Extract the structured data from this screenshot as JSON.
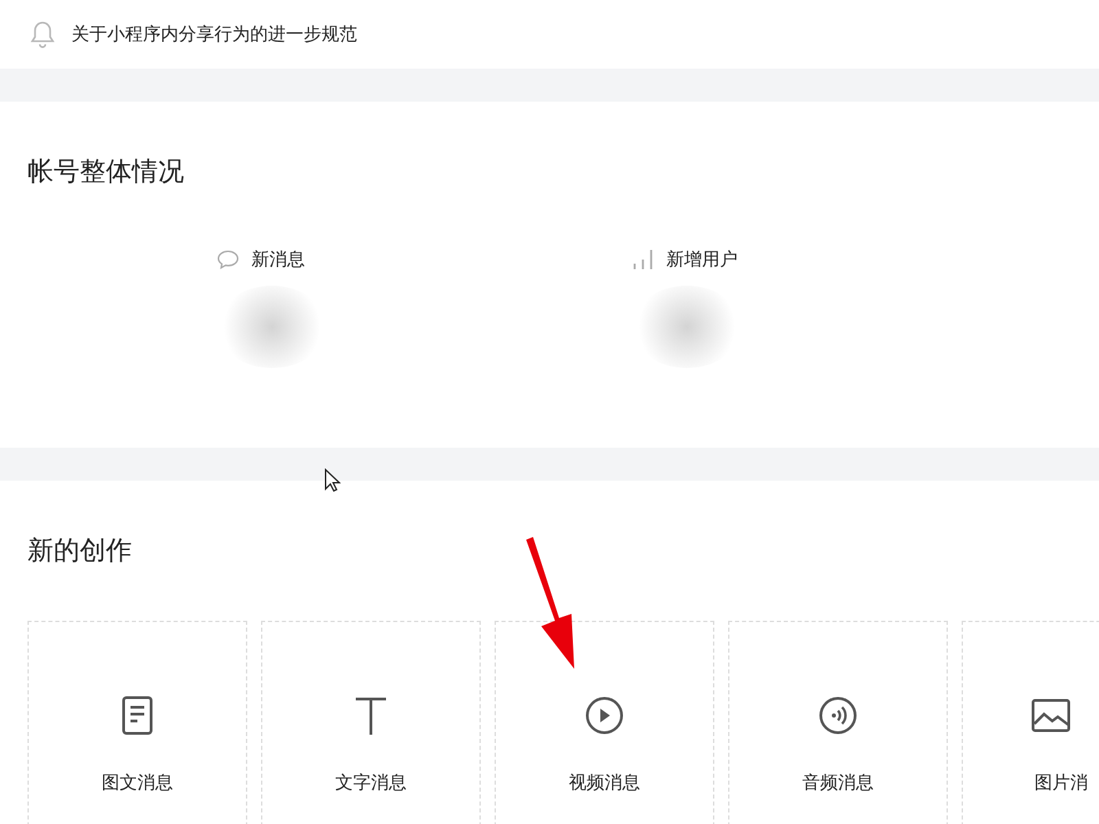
{
  "notice": {
    "text": "关于小程序内分享行为的进一步规范"
  },
  "account_overview": {
    "title": "帐号整体情况",
    "stats": [
      {
        "kind": "messages",
        "label": "新消息"
      },
      {
        "kind": "users",
        "label": "新增用户"
      }
    ]
  },
  "new_creation": {
    "title": "新的创作",
    "cards": [
      {
        "kind": "article",
        "label": "图文消息"
      },
      {
        "kind": "text",
        "label": "文字消息"
      },
      {
        "kind": "video",
        "label": "视频消息"
      },
      {
        "kind": "audio",
        "label": "音频消息"
      },
      {
        "kind": "image",
        "label": "图片消"
      }
    ]
  }
}
